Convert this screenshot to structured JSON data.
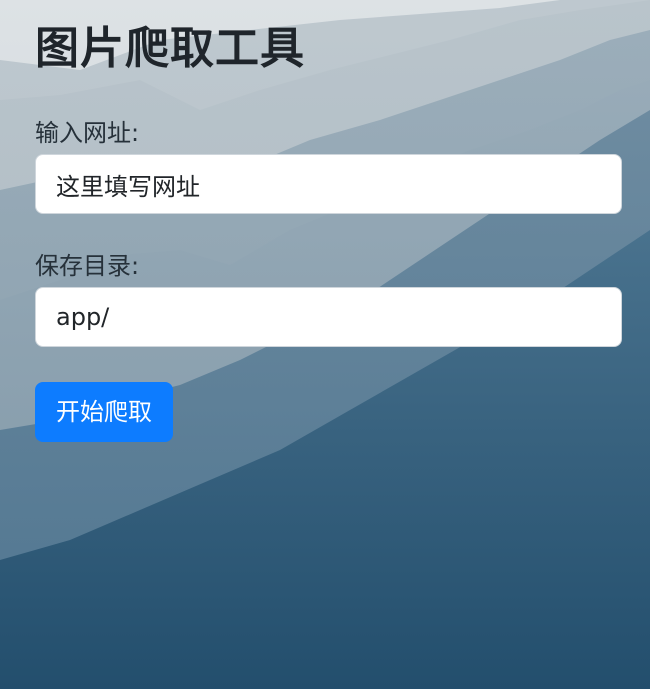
{
  "title": "图片爬取工具",
  "url_field": {
    "label": "输入网址:",
    "value": "这里填写网址"
  },
  "dir_field": {
    "label": "保存目录:",
    "value": "app/"
  },
  "submit_label": "开始爬取",
  "colors": {
    "accent": "#0d7cff",
    "title_text": "#1f252b",
    "input_bg": "#ffffff"
  },
  "background": {
    "scene": "misty-mountain-photo"
  }
}
